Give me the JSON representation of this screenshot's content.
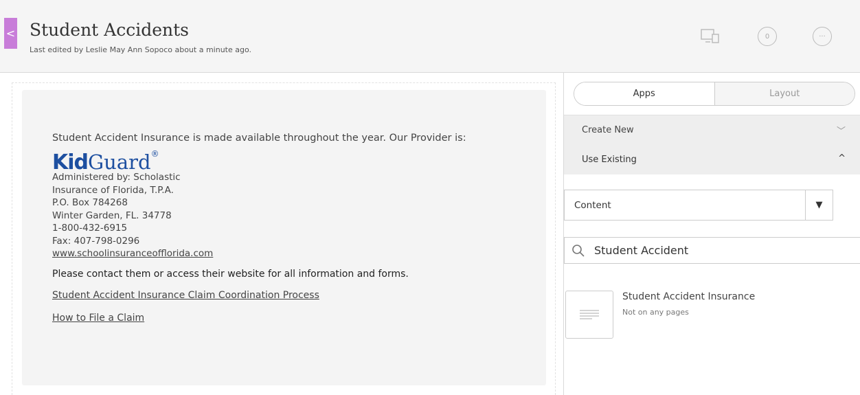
{
  "header": {
    "back_glyph": "<",
    "title": "Student Accidents",
    "subtitle": "Last edited by Leslie May Ann Sopoco about a minute ago.",
    "comment_count": "0",
    "more_glyph": "···"
  },
  "content": {
    "intro": "Student Accident Insurance is made available throughout the year. Our Provider is:",
    "logo": {
      "part1": "Kid",
      "part2": "Guard",
      "reg": "®"
    },
    "address": [
      "Administered by: Scholastic",
      "Insurance of Florida, T.P.A.",
      "P.O. Box 784268",
      "Winter Garden, FL.  34778",
      "1-800-432-6915",
      "Fax: 407-798-0296"
    ],
    "website": "www.schoolinsuranceofflorida.com",
    "contact_note": "Please contact them or access their website for all information and forms.",
    "link_claim_process": "Student Accident Insurance Claim Coordination Process",
    "link_file_claim": "How to File a Claim"
  },
  "panel": {
    "tabs": [
      {
        "label": "Apps",
        "active": true
      },
      {
        "label": "Layout",
        "active": false
      }
    ],
    "sections": [
      {
        "label": "Create New",
        "chevron": "﹀"
      },
      {
        "label": "Use Existing",
        "chevron": "^"
      }
    ],
    "select": {
      "value": "Content",
      "arrow": "▼"
    },
    "search": {
      "value": "Student Accident"
    },
    "results": [
      {
        "title": "Student Accident Insurance",
        "status": "Not on any pages"
      }
    ]
  },
  "icons": {
    "device": "devices-icon",
    "comments": "comment-icon",
    "more": "more-icon",
    "search": "search-icon",
    "doc": "document-icon"
  },
  "colors": {
    "accent": "#c87dd9",
    "logo_blue": "#1d4fa0"
  }
}
